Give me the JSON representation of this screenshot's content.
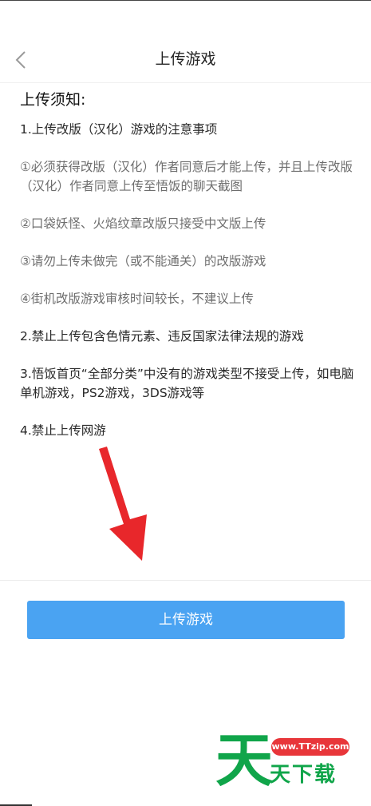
{
  "header": {
    "title": "上传游戏",
    "back_icon": "chevron-left-icon"
  },
  "notice": {
    "heading": "上传须知:",
    "items": [
      "1.上传改版（汉化）游戏的注意事项",
      "①必须获得改版（汉化）作者同意后才能上传，并且上传改版（汉化）作者同意上传至悟饭的聊天截图",
      "②口袋妖怪、火焰纹章改版只接受中文版上传",
      "③请勿上传未做完（或不能通关）的改版游戏",
      "④街机改版游戏审核时间较长，不建议上传",
      "2.禁止上传包含色情元素、违反国家法律法规的游戏",
      "3.悟饭首页“全部分类”中没有的游戏类型不接受上传，如电脑单机游戏，PS2游戏，3DS游戏等",
      "4.禁止上传网游"
    ]
  },
  "button": {
    "upload_label": "上传游戏"
  },
  "watermark": {
    "glyph": "天",
    "url": "www.TTzip.com",
    "text": "天下载"
  },
  "colors": {
    "button_blue": "#4aa3f2",
    "arrow_red": "#e8272b",
    "watermark_green": "#10a54a",
    "watermark_red": "#e8363a"
  }
}
